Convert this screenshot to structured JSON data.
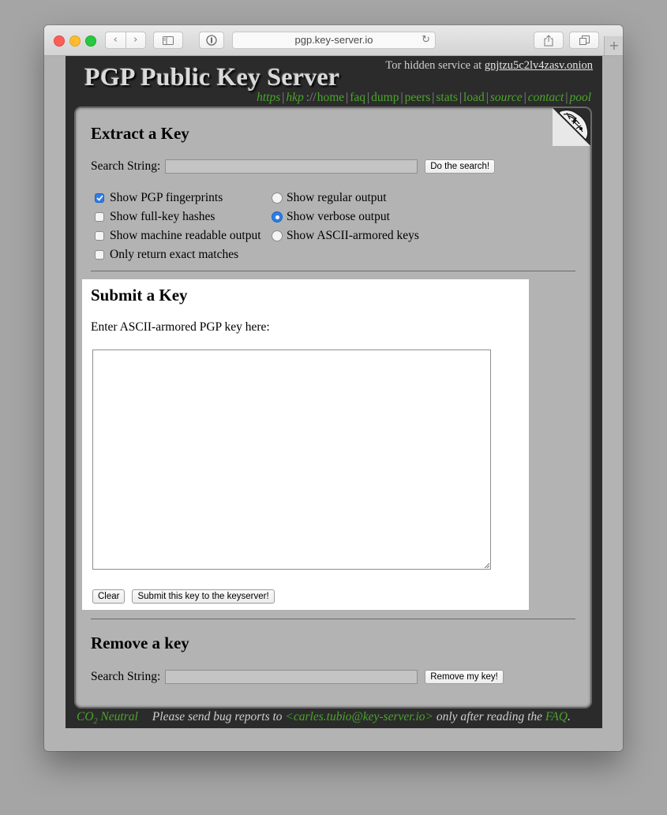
{
  "browser": {
    "address": "pgp.key-server.io",
    "colors": {
      "close": "#fc5f57",
      "minimize": "#fdbc2e",
      "maximize": "#28c840"
    },
    "icons": [
      "back-icon",
      "forward-icon",
      "sidebar-icon",
      "reader-icon",
      "reload-icon",
      "share-icon",
      "tabs-icon",
      "new-tab-icon"
    ]
  },
  "header": {
    "title": "PGP Public Key Server",
    "tor_prefix": "Tor hidden service at ",
    "tor_link": "gnjtzu5c2lv4zasv.onion",
    "nav": {
      "https": "https",
      "hkp": "hkp",
      "scheme_sep": "://",
      "home": "home",
      "faq": "faq",
      "dump": "dump",
      "peers": "peers",
      "stats": "stats",
      "load": "load",
      "source": "source",
      "contact": "contact",
      "pool": "pool",
      "sep": "|"
    },
    "link_color": "#4aa52a"
  },
  "extract": {
    "heading": "Extract a Key",
    "search_label": "Search String:",
    "search_value": "",
    "search_button": "Do the search!",
    "options": {
      "fingerprints": {
        "label": "Show PGP fingerprints",
        "checked": true
      },
      "hashes": {
        "label": "Show full-key hashes",
        "checked": false
      },
      "machine": {
        "label": "Show machine readable output",
        "checked": false
      },
      "exact": {
        "label": "Only return exact matches",
        "checked": false
      },
      "regular": {
        "label": "Show regular output",
        "selected": false
      },
      "verbose": {
        "label": "Show verbose output",
        "selected": true
      },
      "ascii": {
        "label": "Show ASCII-armored keys",
        "selected": false
      }
    }
  },
  "submit": {
    "heading": "Submit a Key",
    "label": "Enter ASCII-armored PGP key here:",
    "key_value": "",
    "clear_button": "Clear",
    "submit_button": "Submit this key to the keyserver!"
  },
  "remove": {
    "heading": "Remove a key",
    "search_label": "Search String:",
    "search_value": "",
    "remove_button": "Remove my key!"
  },
  "footer": {
    "co2": "CO",
    "co2_sub": "2",
    "neutral": " Neutral",
    "bug_text": "Please send bug reports to ",
    "email": "<carles.tubio@key-server.io>",
    "after_text": " only after reading the ",
    "faq": "FAQ",
    "period": "."
  }
}
